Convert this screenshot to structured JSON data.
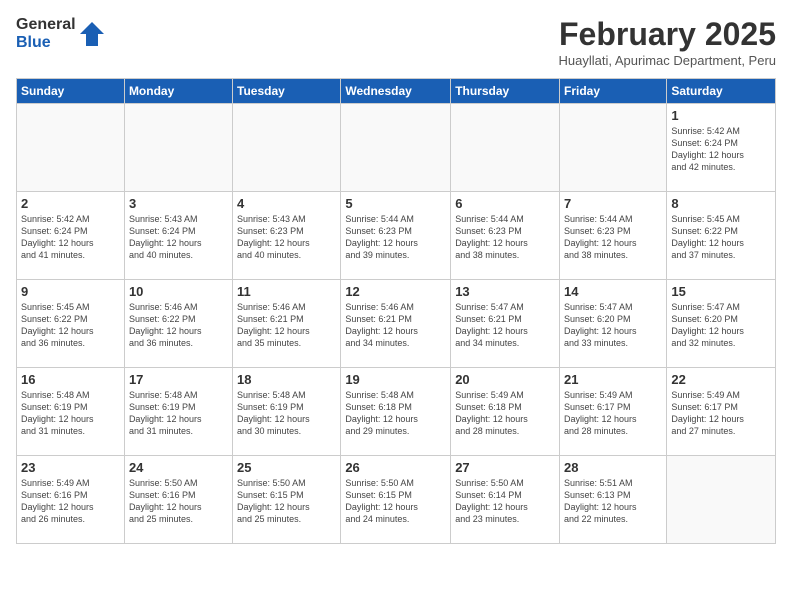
{
  "header": {
    "logo_general": "General",
    "logo_blue": "Blue",
    "title": "February 2025",
    "subtitle": "Huayllati, Apurimac Department, Peru"
  },
  "weekdays": [
    "Sunday",
    "Monday",
    "Tuesday",
    "Wednesday",
    "Thursday",
    "Friday",
    "Saturday"
  ],
  "weeks": [
    [
      {
        "day": "",
        "text": ""
      },
      {
        "day": "",
        "text": ""
      },
      {
        "day": "",
        "text": ""
      },
      {
        "day": "",
        "text": ""
      },
      {
        "day": "",
        "text": ""
      },
      {
        "day": "",
        "text": ""
      },
      {
        "day": "1",
        "text": "Sunrise: 5:42 AM\nSunset: 6:24 PM\nDaylight: 12 hours\nand 42 minutes."
      }
    ],
    [
      {
        "day": "2",
        "text": "Sunrise: 5:42 AM\nSunset: 6:24 PM\nDaylight: 12 hours\nand 41 minutes."
      },
      {
        "day": "3",
        "text": "Sunrise: 5:43 AM\nSunset: 6:24 PM\nDaylight: 12 hours\nand 40 minutes."
      },
      {
        "day": "4",
        "text": "Sunrise: 5:43 AM\nSunset: 6:23 PM\nDaylight: 12 hours\nand 40 minutes."
      },
      {
        "day": "5",
        "text": "Sunrise: 5:44 AM\nSunset: 6:23 PM\nDaylight: 12 hours\nand 39 minutes."
      },
      {
        "day": "6",
        "text": "Sunrise: 5:44 AM\nSunset: 6:23 PM\nDaylight: 12 hours\nand 38 minutes."
      },
      {
        "day": "7",
        "text": "Sunrise: 5:44 AM\nSunset: 6:23 PM\nDaylight: 12 hours\nand 38 minutes."
      },
      {
        "day": "8",
        "text": "Sunrise: 5:45 AM\nSunset: 6:22 PM\nDaylight: 12 hours\nand 37 minutes."
      }
    ],
    [
      {
        "day": "9",
        "text": "Sunrise: 5:45 AM\nSunset: 6:22 PM\nDaylight: 12 hours\nand 36 minutes."
      },
      {
        "day": "10",
        "text": "Sunrise: 5:46 AM\nSunset: 6:22 PM\nDaylight: 12 hours\nand 36 minutes."
      },
      {
        "day": "11",
        "text": "Sunrise: 5:46 AM\nSunset: 6:21 PM\nDaylight: 12 hours\nand 35 minutes."
      },
      {
        "day": "12",
        "text": "Sunrise: 5:46 AM\nSunset: 6:21 PM\nDaylight: 12 hours\nand 34 minutes."
      },
      {
        "day": "13",
        "text": "Sunrise: 5:47 AM\nSunset: 6:21 PM\nDaylight: 12 hours\nand 34 minutes."
      },
      {
        "day": "14",
        "text": "Sunrise: 5:47 AM\nSunset: 6:20 PM\nDaylight: 12 hours\nand 33 minutes."
      },
      {
        "day": "15",
        "text": "Sunrise: 5:47 AM\nSunset: 6:20 PM\nDaylight: 12 hours\nand 32 minutes."
      }
    ],
    [
      {
        "day": "16",
        "text": "Sunrise: 5:48 AM\nSunset: 6:19 PM\nDaylight: 12 hours\nand 31 minutes."
      },
      {
        "day": "17",
        "text": "Sunrise: 5:48 AM\nSunset: 6:19 PM\nDaylight: 12 hours\nand 31 minutes."
      },
      {
        "day": "18",
        "text": "Sunrise: 5:48 AM\nSunset: 6:19 PM\nDaylight: 12 hours\nand 30 minutes."
      },
      {
        "day": "19",
        "text": "Sunrise: 5:48 AM\nSunset: 6:18 PM\nDaylight: 12 hours\nand 29 minutes."
      },
      {
        "day": "20",
        "text": "Sunrise: 5:49 AM\nSunset: 6:18 PM\nDaylight: 12 hours\nand 28 minutes."
      },
      {
        "day": "21",
        "text": "Sunrise: 5:49 AM\nSunset: 6:17 PM\nDaylight: 12 hours\nand 28 minutes."
      },
      {
        "day": "22",
        "text": "Sunrise: 5:49 AM\nSunset: 6:17 PM\nDaylight: 12 hours\nand 27 minutes."
      }
    ],
    [
      {
        "day": "23",
        "text": "Sunrise: 5:49 AM\nSunset: 6:16 PM\nDaylight: 12 hours\nand 26 minutes."
      },
      {
        "day": "24",
        "text": "Sunrise: 5:50 AM\nSunset: 6:16 PM\nDaylight: 12 hours\nand 25 minutes."
      },
      {
        "day": "25",
        "text": "Sunrise: 5:50 AM\nSunset: 6:15 PM\nDaylight: 12 hours\nand 25 minutes."
      },
      {
        "day": "26",
        "text": "Sunrise: 5:50 AM\nSunset: 6:15 PM\nDaylight: 12 hours\nand 24 minutes."
      },
      {
        "day": "27",
        "text": "Sunrise: 5:50 AM\nSunset: 6:14 PM\nDaylight: 12 hours\nand 23 minutes."
      },
      {
        "day": "28",
        "text": "Sunrise: 5:51 AM\nSunset: 6:13 PM\nDaylight: 12 hours\nand 22 minutes."
      },
      {
        "day": "",
        "text": ""
      }
    ]
  ]
}
